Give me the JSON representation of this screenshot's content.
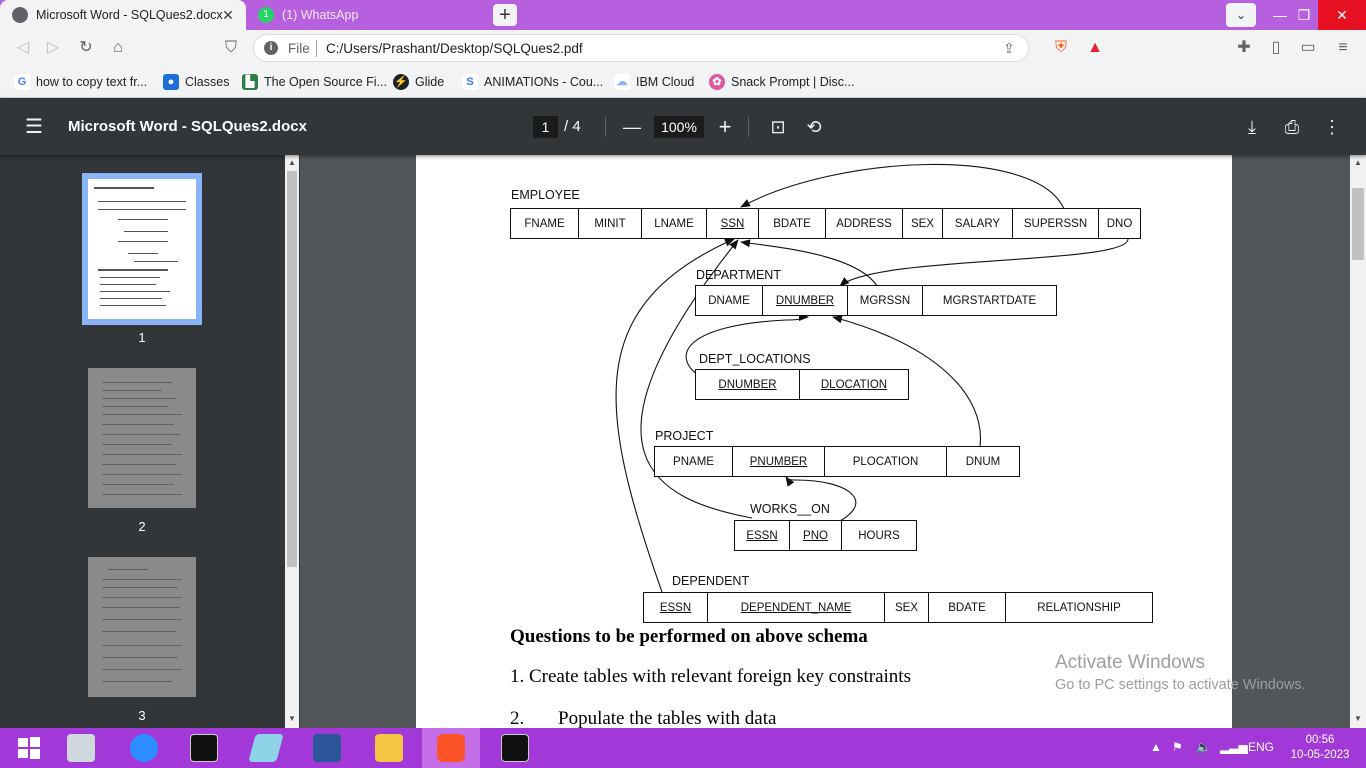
{
  "browser": {
    "tabs": [
      {
        "title": "Microsoft Word - SQLQues2.docx",
        "active": true
      },
      {
        "title": "(1) WhatsApp",
        "active": false
      }
    ],
    "scheme": "File",
    "url": "C:/Users/Prashant/Desktop/SQLQues2.pdf",
    "bookmarks": [
      {
        "label": "how to copy text fr...",
        "icon": "google-icon",
        "color": "#4285f4"
      },
      {
        "label": "Classes",
        "icon": "classroom-icon",
        "color": "#1e8e3e"
      },
      {
        "label": "The Open Source Fi...",
        "icon": "osf-icon",
        "color": "#202124"
      },
      {
        "label": "Glide",
        "icon": "glide-icon",
        "color": "#202124"
      },
      {
        "label": "ANIMATIONs - Cou...",
        "icon": "course-icon",
        "color": "#2979ff"
      },
      {
        "label": "IBM Cloud",
        "icon": "cloud-icon",
        "color": "#8ab4f8"
      },
      {
        "label": "Snack Prompt | Disc...",
        "icon": "snack-icon",
        "color": "#e056a0"
      }
    ]
  },
  "pdf": {
    "title": "Microsoft Word - SQLQues2.docx",
    "current_page": "1",
    "page_total": "/ 4",
    "zoom": "100%",
    "thumbnails": [
      "1",
      "2",
      "3"
    ]
  },
  "schema": {
    "employee": {
      "name": "EMPLOYEE",
      "cols": [
        "FNAME",
        "MINIT",
        "LNAME",
        "SSN",
        "BDATE",
        "ADDRESS",
        "SEX",
        "SALARY",
        "SUPERSSN",
        "DNO"
      ]
    },
    "department": {
      "name": "DEPARTMENT",
      "cols": [
        "DNAME",
        "DNUMBER",
        "MGRSSN",
        "MGRSTARTDATE"
      ]
    },
    "dept_locations": {
      "name": "DEPT_LOCATIONS",
      "cols": [
        "DNUMBER",
        "DLOCATION"
      ]
    },
    "project": {
      "name": "PROJECT",
      "cols": [
        "PNAME",
        "PNUMBER",
        "PLOCATION",
        "DNUM"
      ]
    },
    "works_on": {
      "name": "WORKS__ON",
      "cols": [
        "ESSN",
        "PNO",
        "HOURS"
      ]
    },
    "dependent": {
      "name": "DEPENDENT",
      "cols": [
        "ESSN",
        "DEPENDENT_NAME",
        "SEX",
        "BDATE",
        "RELATIONSHIP"
      ]
    }
  },
  "questions": {
    "heading": "Questions to be performed on above schema",
    "q1": "1. Create tables with relevant foreign key constraints",
    "q2_num": "2.",
    "q2": "Populate the tables with data"
  },
  "watermark": {
    "line1": "Activate Windows",
    "line2": "Go to PC settings to activate Windows."
  },
  "taskbar": {
    "lang": "ENG",
    "time": "00:56",
    "date": "10-05-2023"
  }
}
